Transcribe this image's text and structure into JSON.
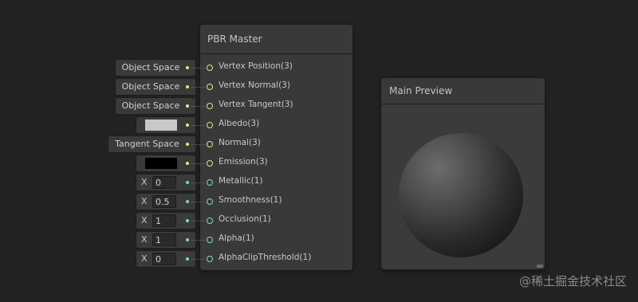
{
  "master_node": {
    "title": "PBR Master",
    "ports": [
      {
        "label": "Vertex Position(3)",
        "kind": "vector"
      },
      {
        "label": "Vertex Normal(3)",
        "kind": "vector"
      },
      {
        "label": "Vertex Tangent(3)",
        "kind": "vector"
      },
      {
        "label": "Albedo(3)",
        "kind": "vector"
      },
      {
        "label": "Normal(3)",
        "kind": "vector"
      },
      {
        "label": "Emission(3)",
        "kind": "vector"
      },
      {
        "label": "Metallic(1)",
        "kind": "float"
      },
      {
        "label": "Smoothness(1)",
        "kind": "float"
      },
      {
        "label": "Occlusion(1)",
        "kind": "float"
      },
      {
        "label": "Alpha(1)",
        "kind": "float"
      },
      {
        "label": "AlphaClipThreshold(1)",
        "kind": "float"
      }
    ]
  },
  "inputs": {
    "vertex_position": "Object Space",
    "vertex_normal": "Object Space",
    "vertex_tangent": "Object Space",
    "albedo_color": "#c8c8c8",
    "normal": "Tangent Space",
    "emission_color": "#000000",
    "axis_label": "X",
    "metallic": "0",
    "smoothness": "0.5",
    "occlusion": "1",
    "alpha": "1",
    "alpha_clip_threshold": "0"
  },
  "preview": {
    "title": "Main Preview"
  },
  "watermark": "@稀土掘金技术社区",
  "colors": {
    "background": "#222222",
    "node": "#393939",
    "vector_port": "#e6e28a",
    "float_port": "#86d4d2"
  }
}
